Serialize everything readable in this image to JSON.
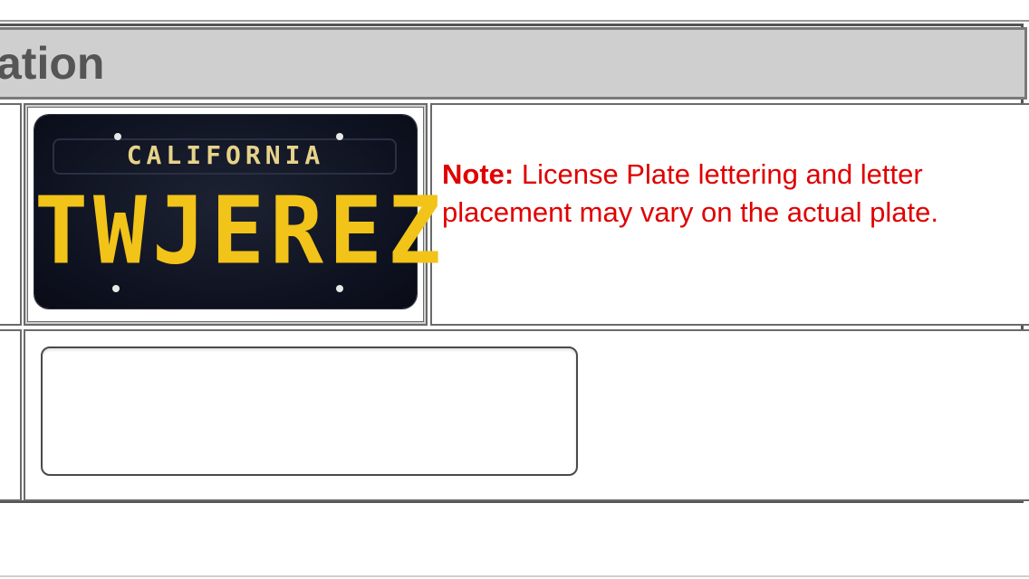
{
  "header": {
    "title": "ation"
  },
  "plate_preview": {
    "state": "CALIFORNIA",
    "plate_text": "TWJEREZ",
    "plate_color": "#0e1220",
    "letter_color": "#f2c318"
  },
  "note": {
    "label": "Note:",
    "text": " License Plate lettering and letter placement may vary on the actual plate."
  },
  "input": {
    "value": ""
  },
  "colors": {
    "header_bg": "#cfcfcf",
    "note_text": "#e00000"
  }
}
